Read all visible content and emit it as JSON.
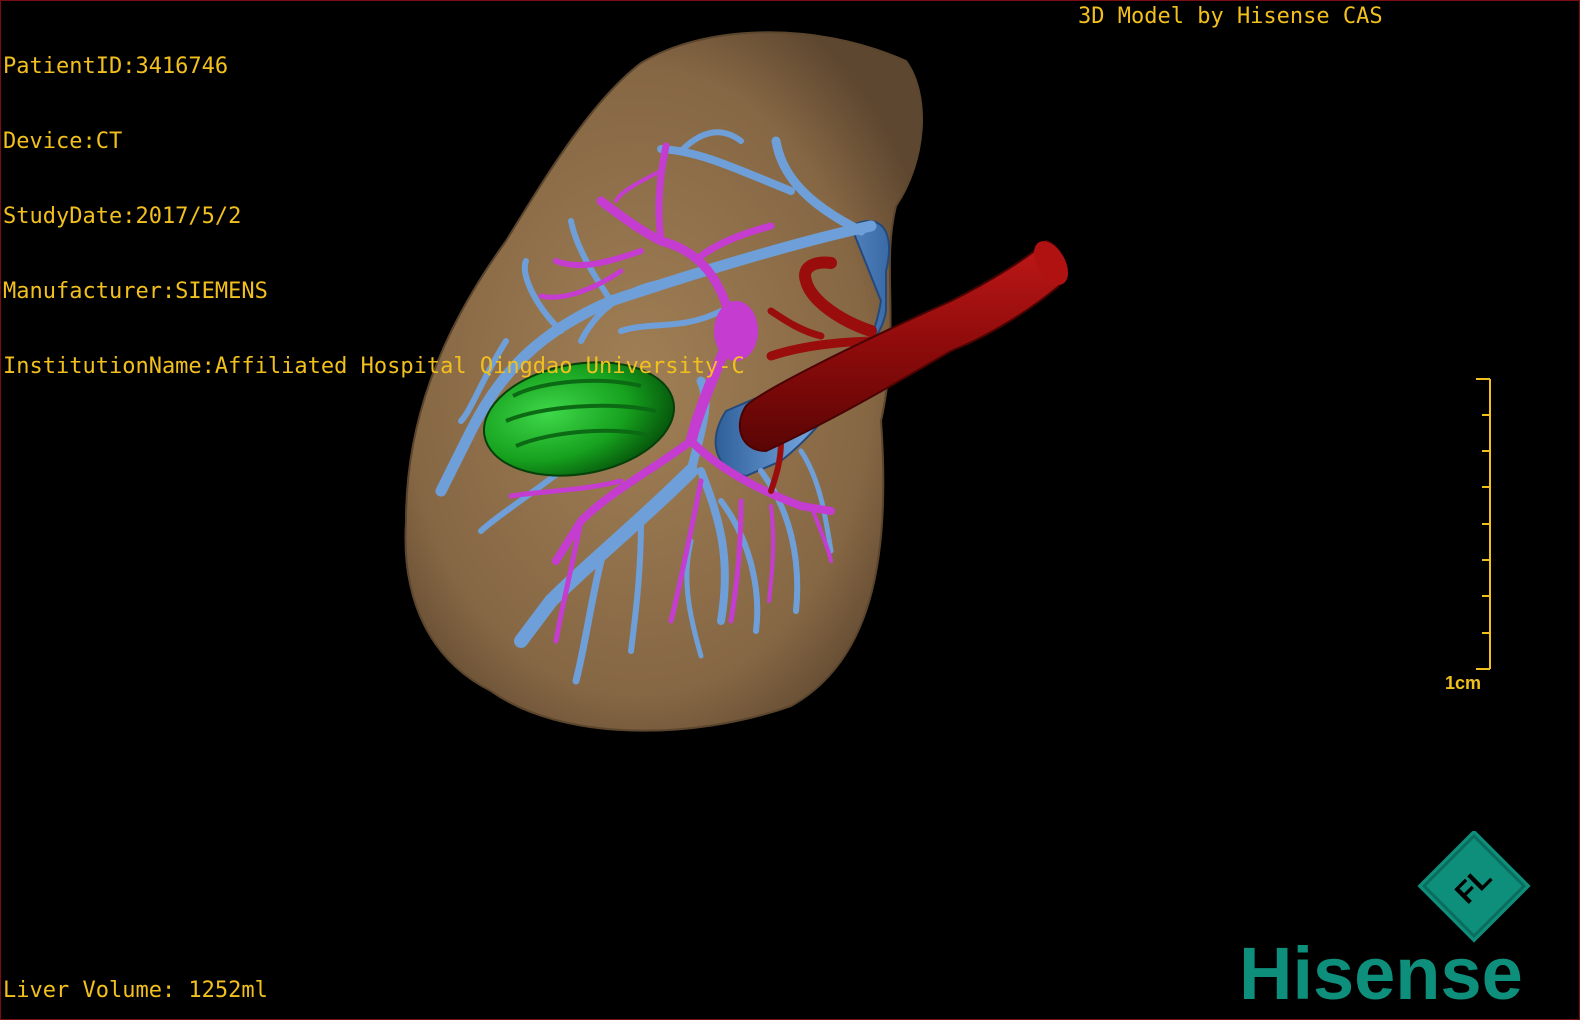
{
  "overlay": {
    "patient_id": "PatientID:3416746",
    "device": "Device:CT",
    "study_date": "StudyDate:2017/5/2",
    "manufacturer": "Manufacturer:SIEMENS",
    "institution": "InstitutionName:Affiliated Hospital Qingdao University-C",
    "credit": "3D Model by Hisense CAS",
    "liver_volume": "Liver Volume: 1252ml"
  },
  "scale_bar": {
    "label": "1cm"
  },
  "logo": {
    "brand": "Hisense",
    "emblem": "FL"
  },
  "colors": {
    "overlay_text": "#f2c01e",
    "liver": "#8c6d48",
    "portal_vein": "#6f9fd8",
    "hepatic_vein": "#c43cd0",
    "tumor": "#1b9a22",
    "artery": "#9a0d0d",
    "brand": "#0e8f7c"
  },
  "structures": [
    "liver-icon",
    "portal-vein-icon",
    "hepatic-vein-icon",
    "tumor-icon",
    "aorta-icon"
  ]
}
